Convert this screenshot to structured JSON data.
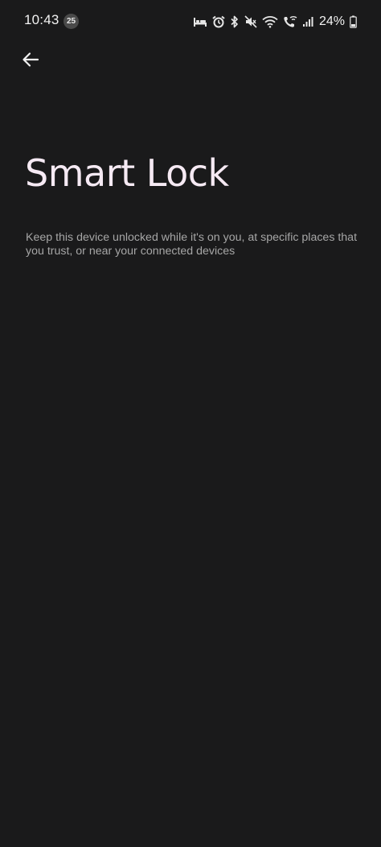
{
  "status_bar": {
    "time": "10:43",
    "notification_badge": "25",
    "battery_percent": "24%",
    "icons": [
      "sleep-mode-icon",
      "alarm-icon",
      "bluetooth-icon",
      "mute-icon",
      "wifi-icon",
      "wifi-calling-icon",
      "signal-icon",
      "battery-icon"
    ]
  },
  "header": {
    "back_icon": "back-arrow-icon"
  },
  "page": {
    "title": "Smart Lock",
    "description": "Keep this device unlocked while it's on you, at specific places that you trust, or near your connected devices"
  },
  "colors": {
    "background": "#1a1a1b",
    "title": "#f6eaf4",
    "description": "#a6a6a6"
  }
}
